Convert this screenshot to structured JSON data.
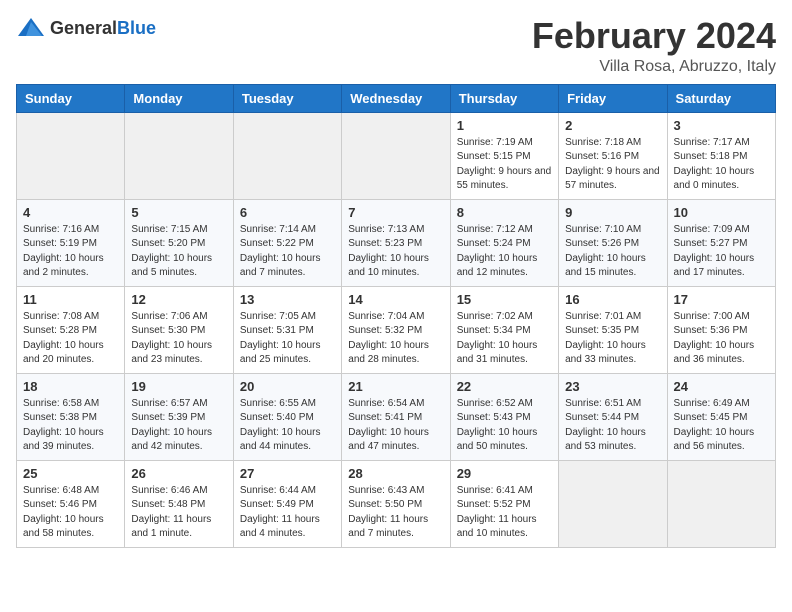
{
  "logo": {
    "general": "General",
    "blue": "Blue"
  },
  "title": "February 2024",
  "subtitle": "Villa Rosa, Abruzzo, Italy",
  "weekdays": [
    "Sunday",
    "Monday",
    "Tuesday",
    "Wednesday",
    "Thursday",
    "Friday",
    "Saturday"
  ],
  "weeks": [
    [
      {
        "day": "",
        "info": ""
      },
      {
        "day": "",
        "info": ""
      },
      {
        "day": "",
        "info": ""
      },
      {
        "day": "",
        "info": ""
      },
      {
        "day": "1",
        "info": "Sunrise: 7:19 AM\nSunset: 5:15 PM\nDaylight: 9 hours and 55 minutes."
      },
      {
        "day": "2",
        "info": "Sunrise: 7:18 AM\nSunset: 5:16 PM\nDaylight: 9 hours and 57 minutes."
      },
      {
        "day": "3",
        "info": "Sunrise: 7:17 AM\nSunset: 5:18 PM\nDaylight: 10 hours and 0 minutes."
      }
    ],
    [
      {
        "day": "4",
        "info": "Sunrise: 7:16 AM\nSunset: 5:19 PM\nDaylight: 10 hours and 2 minutes."
      },
      {
        "day": "5",
        "info": "Sunrise: 7:15 AM\nSunset: 5:20 PM\nDaylight: 10 hours and 5 minutes."
      },
      {
        "day": "6",
        "info": "Sunrise: 7:14 AM\nSunset: 5:22 PM\nDaylight: 10 hours and 7 minutes."
      },
      {
        "day": "7",
        "info": "Sunrise: 7:13 AM\nSunset: 5:23 PM\nDaylight: 10 hours and 10 minutes."
      },
      {
        "day": "8",
        "info": "Sunrise: 7:12 AM\nSunset: 5:24 PM\nDaylight: 10 hours and 12 minutes."
      },
      {
        "day": "9",
        "info": "Sunrise: 7:10 AM\nSunset: 5:26 PM\nDaylight: 10 hours and 15 minutes."
      },
      {
        "day": "10",
        "info": "Sunrise: 7:09 AM\nSunset: 5:27 PM\nDaylight: 10 hours and 17 minutes."
      }
    ],
    [
      {
        "day": "11",
        "info": "Sunrise: 7:08 AM\nSunset: 5:28 PM\nDaylight: 10 hours and 20 minutes."
      },
      {
        "day": "12",
        "info": "Sunrise: 7:06 AM\nSunset: 5:30 PM\nDaylight: 10 hours and 23 minutes."
      },
      {
        "day": "13",
        "info": "Sunrise: 7:05 AM\nSunset: 5:31 PM\nDaylight: 10 hours and 25 minutes."
      },
      {
        "day": "14",
        "info": "Sunrise: 7:04 AM\nSunset: 5:32 PM\nDaylight: 10 hours and 28 minutes."
      },
      {
        "day": "15",
        "info": "Sunrise: 7:02 AM\nSunset: 5:34 PM\nDaylight: 10 hours and 31 minutes."
      },
      {
        "day": "16",
        "info": "Sunrise: 7:01 AM\nSunset: 5:35 PM\nDaylight: 10 hours and 33 minutes."
      },
      {
        "day": "17",
        "info": "Sunrise: 7:00 AM\nSunset: 5:36 PM\nDaylight: 10 hours and 36 minutes."
      }
    ],
    [
      {
        "day": "18",
        "info": "Sunrise: 6:58 AM\nSunset: 5:38 PM\nDaylight: 10 hours and 39 minutes."
      },
      {
        "day": "19",
        "info": "Sunrise: 6:57 AM\nSunset: 5:39 PM\nDaylight: 10 hours and 42 minutes."
      },
      {
        "day": "20",
        "info": "Sunrise: 6:55 AM\nSunset: 5:40 PM\nDaylight: 10 hours and 44 minutes."
      },
      {
        "day": "21",
        "info": "Sunrise: 6:54 AM\nSunset: 5:41 PM\nDaylight: 10 hours and 47 minutes."
      },
      {
        "day": "22",
        "info": "Sunrise: 6:52 AM\nSunset: 5:43 PM\nDaylight: 10 hours and 50 minutes."
      },
      {
        "day": "23",
        "info": "Sunrise: 6:51 AM\nSunset: 5:44 PM\nDaylight: 10 hours and 53 minutes."
      },
      {
        "day": "24",
        "info": "Sunrise: 6:49 AM\nSunset: 5:45 PM\nDaylight: 10 hours and 56 minutes."
      }
    ],
    [
      {
        "day": "25",
        "info": "Sunrise: 6:48 AM\nSunset: 5:46 PM\nDaylight: 10 hours and 58 minutes."
      },
      {
        "day": "26",
        "info": "Sunrise: 6:46 AM\nSunset: 5:48 PM\nDaylight: 11 hours and 1 minute."
      },
      {
        "day": "27",
        "info": "Sunrise: 6:44 AM\nSunset: 5:49 PM\nDaylight: 11 hours and 4 minutes."
      },
      {
        "day": "28",
        "info": "Sunrise: 6:43 AM\nSunset: 5:50 PM\nDaylight: 11 hours and 7 minutes."
      },
      {
        "day": "29",
        "info": "Sunrise: 6:41 AM\nSunset: 5:52 PM\nDaylight: 11 hours and 10 minutes."
      },
      {
        "day": "",
        "info": ""
      },
      {
        "day": "",
        "info": ""
      }
    ]
  ]
}
